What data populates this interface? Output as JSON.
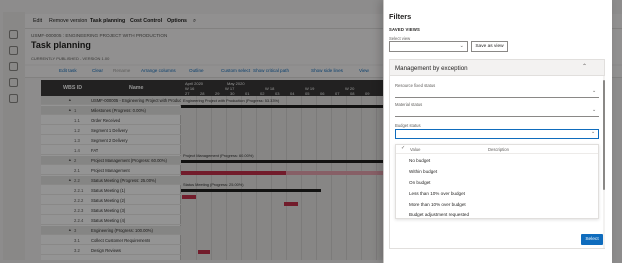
{
  "app": {
    "menu": [
      "Edit",
      "Remove version",
      "Task planning",
      "Cost Control",
      "Options"
    ],
    "breadcrumb": "USMF-000005 : ENGINEERING PROJECT WITH PRODUCTION",
    "title": "Task planning",
    "subcaption": "CURRENTLY PUBLISHED - VERSION 1.00",
    "toolbar": [
      "Edit task",
      "Clear",
      "Rename",
      "Arrange columns",
      "Outline",
      "Custom select",
      "Show critical path",
      "Show side lines",
      "View"
    ],
    "grid_headers": {
      "wbs": "WBS ID",
      "name": "Name"
    },
    "rows": [
      {
        "wbs": "",
        "name": "USMF-000005 - Engineering Project with Production",
        "group": true
      },
      {
        "wbs": "1",
        "name": "Milestones (Progress: 0.00%)",
        "group": true
      },
      {
        "wbs": "1.1",
        "name": "Order Received",
        "group": false
      },
      {
        "wbs": "1.2",
        "name": "Segment 1 Delivery",
        "group": false
      },
      {
        "wbs": "1.3",
        "name": "Segment 2 Delivery",
        "group": false
      },
      {
        "wbs": "1.4",
        "name": "FAT",
        "group": false
      },
      {
        "wbs": "2",
        "name": "Project Management (Progress: 60.00%)",
        "group": true
      },
      {
        "wbs": "2.1",
        "name": "Project Management",
        "group": false
      },
      {
        "wbs": "2.2",
        "name": "Status Meeting (Progress: 25.00%)",
        "group": true
      },
      {
        "wbs": "2.2.1",
        "name": "Status Meeting (1)",
        "group": false
      },
      {
        "wbs": "2.2.2",
        "name": "Status Meeting (2)",
        "group": false
      },
      {
        "wbs": "2.2.3",
        "name": "Status Meeting (3)",
        "group": false
      },
      {
        "wbs": "2.2.4",
        "name": "Status Meeting (4)",
        "group": false
      },
      {
        "wbs": "3",
        "name": "Engineering (Progress: 100.00%)",
        "group": true
      },
      {
        "wbs": "3.1",
        "name": "Collect Customer Requirements",
        "group": false
      },
      {
        "wbs": "3.2",
        "name": "Design Reviews",
        "group": false
      }
    ],
    "gantt": {
      "months": [
        "April 2020",
        "May 2020"
      ],
      "weeks": [
        "W 16",
        "W 17",
        "W 18",
        "W 19",
        "W 20"
      ],
      "days": [
        "27",
        "28",
        "29",
        "30",
        "01",
        "02",
        "03",
        "04",
        "05",
        "06",
        "07",
        "08",
        "09"
      ],
      "tasks": [
        "Engineering Project with Production (Progress: 53.33%)",
        "Project Management (Progress: 60.00%)",
        "Status Meeting (Progress: 25.00%)"
      ]
    }
  },
  "filters": {
    "title": "Filters",
    "saved_views_heading": "SAVED VIEWS",
    "select_view_label": "Select view",
    "select_view_value": "",
    "save_as_view_label": "Save as view",
    "section_title": "Management by exception",
    "fields": [
      {
        "label": "Resource fixed status",
        "value": ""
      },
      {
        "label": "Material status",
        "value": ""
      },
      {
        "label": "Budget status",
        "value": ""
      }
    ],
    "dropdown": {
      "columns": [
        "Value",
        "Description"
      ],
      "options": [
        "No budget",
        "Within budget",
        "On budget",
        "Less than 10% over budget",
        "More than 10% over budget",
        "Budget adjustment requested"
      ]
    },
    "select_button_label": "Select"
  },
  "colors": {
    "accent": "#0f6cbd",
    "grid_header": "#3b3a39",
    "bar_red": "#c4314b",
    "bar_dark": "#201f1e"
  }
}
